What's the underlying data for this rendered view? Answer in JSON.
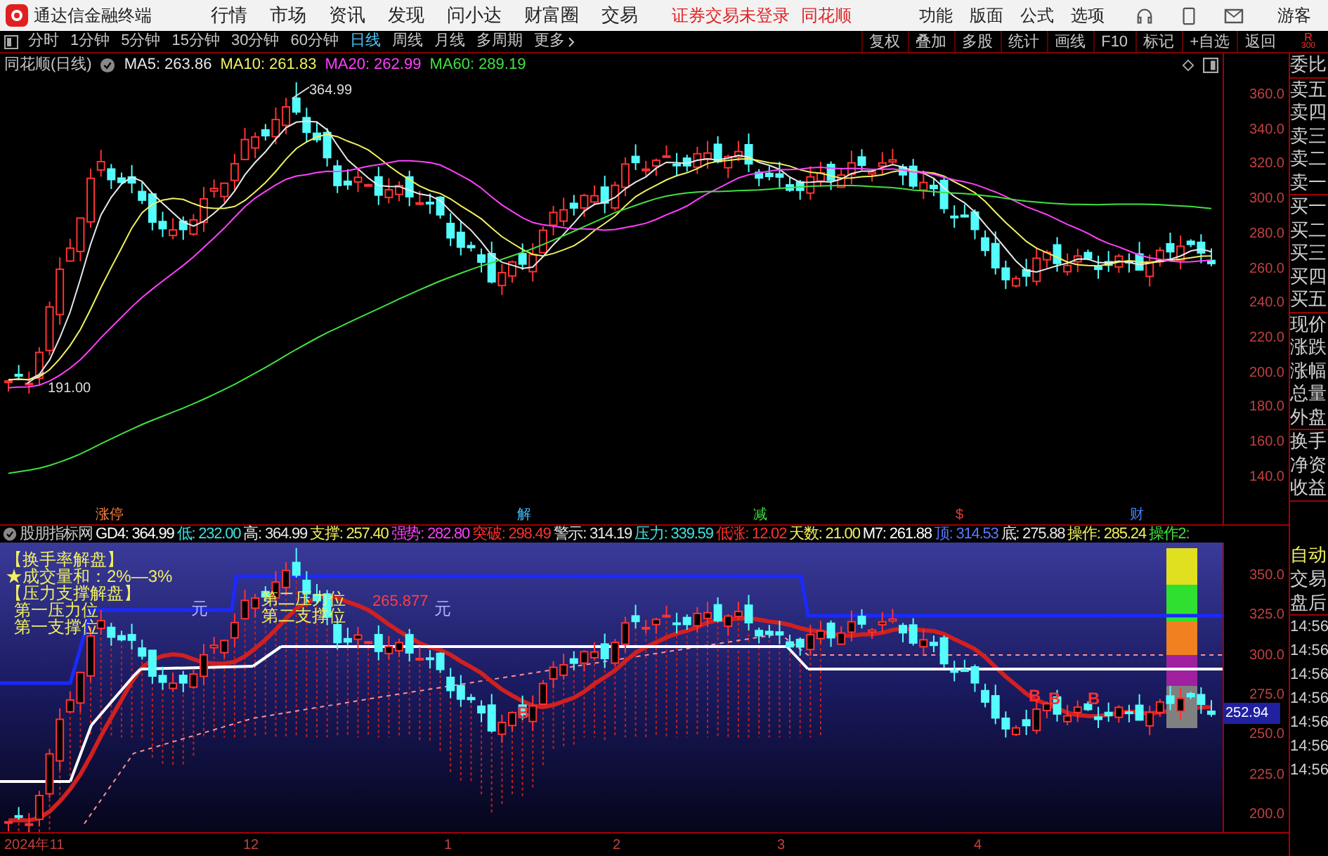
{
  "app_bar": {
    "title": "通达信金融终端",
    "menus": [
      "行情",
      "市场",
      "资讯",
      "发现",
      "问小达",
      "财富圈",
      "交易"
    ],
    "notices": [
      "证券交易未登录",
      "同花顺"
    ],
    "right_menus": [
      "功能",
      "版面",
      "公式",
      "选项"
    ],
    "user": "游客"
  },
  "toolbar": {
    "periods": [
      {
        "label": "分时",
        "selected": false
      },
      {
        "label": "1分钟",
        "selected": false
      },
      {
        "label": "5分钟",
        "selected": false
      },
      {
        "label": "15分钟",
        "selected": false
      },
      {
        "label": "30分钟",
        "selected": false
      },
      {
        "label": "60分钟",
        "selected": false
      },
      {
        "label": "日线",
        "selected": true
      },
      {
        "label": "周线",
        "selected": false
      },
      {
        "label": "月线",
        "selected": false
      },
      {
        "label": "多周期",
        "selected": false
      },
      {
        "label": "更多",
        "selected": false
      }
    ],
    "buttons": [
      "复权",
      "叠加",
      "多股",
      "统计",
      "画线",
      "F10",
      "标记",
      "+自选",
      "返回"
    ],
    "corner": [
      "R",
      "300"
    ]
  },
  "main_chart": {
    "title": "同花顺(日线)",
    "ma": [
      {
        "label": "MA5: 263.86",
        "color": "#e8e8e8"
      },
      {
        "label": "MA10: 261.83",
        "color": "#f0f060"
      },
      {
        "label": "MA20: 262.99",
        "color": "#ff40ff"
      },
      {
        "label": "MA60: 289.19",
        "color": "#40e040"
      }
    ],
    "price_axis": [
      "360.0",
      "340.0",
      "320.0",
      "300.0",
      "280.0",
      "260.0",
      "240.0",
      "220.0",
      "200.0",
      "180.0",
      "160.0",
      "140.0"
    ],
    "high_label": "364.99",
    "low_label": "191.00",
    "events": [
      {
        "label": "涨停",
        "color": "#ff8040"
      },
      {
        "label": "解",
        "color": "#40c0ff"
      },
      {
        "label": "减",
        "color": "#40e040"
      },
      {
        "label": "$",
        "color": "#ff3030"
      },
      {
        "label": "财",
        "color": "#4080ff"
      }
    ]
  },
  "indicator": {
    "name": "股朋指标网",
    "values": [
      {
        "label": "GD4: 364.99",
        "color": "#ffffff"
      },
      {
        "label": "低: 232.00",
        "color": "#40e0e0"
      },
      {
        "label": "高: 364.99",
        "color": "#e8e8e8"
      },
      {
        "label": "支撑: 257.40",
        "color": "#f0f060"
      },
      {
        "label": "强势: 282.80",
        "color": "#ff40ff"
      },
      {
        "label": "突破: 298.49",
        "color": "#ff3030"
      },
      {
        "label": "警示: 314.19",
        "color": "#e8e8e8"
      },
      {
        "label": "压力: 339.59",
        "color": "#40e0e0"
      },
      {
        "label": "低涨: 12.02",
        "color": "#ff3030"
      },
      {
        "label": "天数: 21.00",
        "color": "#f0f060"
      },
      {
        "label": "M7: 261.88",
        "color": "#ffffff"
      },
      {
        "label": "顶: 314.53",
        "color": "#5a78ff"
      },
      {
        "label": "底: 275.88",
        "color": "#e8e8e8"
      },
      {
        "label": "操作: 285.24",
        "color": "#f0f060"
      },
      {
        "label": "操作2:",
        "color": "#40e040"
      }
    ],
    "notes": [
      "【换手率解盘】",
      "★成交量和：2%—3%",
      "【压力支撑解盘】",
      "第一压力位",
      "第一支撑位"
    ],
    "levels": [
      "第二压力位",
      "第二支撑位"
    ],
    "price_note": "265.877",
    "units": [
      "元",
      "元"
    ],
    "signals": [
      "B",
      "B",
      "B",
      "B"
    ],
    "price_axis": [
      "350.0",
      "325.0",
      "300.0",
      "275.0",
      "250.0",
      "225.0",
      "200.0"
    ],
    "price_tag": "252.94"
  },
  "quote_panel": {
    "groups": [
      [
        "委比"
      ],
      [
        "卖五",
        "卖四",
        "卖三",
        "卖二",
        "卖一"
      ],
      [
        "买一",
        "买二",
        "买三",
        "买四",
        "买五"
      ],
      [
        "现价",
        "涨跌",
        "涨幅",
        "总量",
        "外盘"
      ],
      [
        "换手",
        "净资",
        "收益"
      ]
    ]
  },
  "trade_panel": {
    "labels": [
      "自动",
      "交易",
      "盘后"
    ],
    "times": [
      "14:56",
      "14:56",
      "14:56",
      "14:56",
      "14:56",
      "14:56",
      "14:56"
    ]
  },
  "time_axis": [
    "2024年11",
    "12",
    "1",
    "2",
    "3",
    "4"
  ]
}
